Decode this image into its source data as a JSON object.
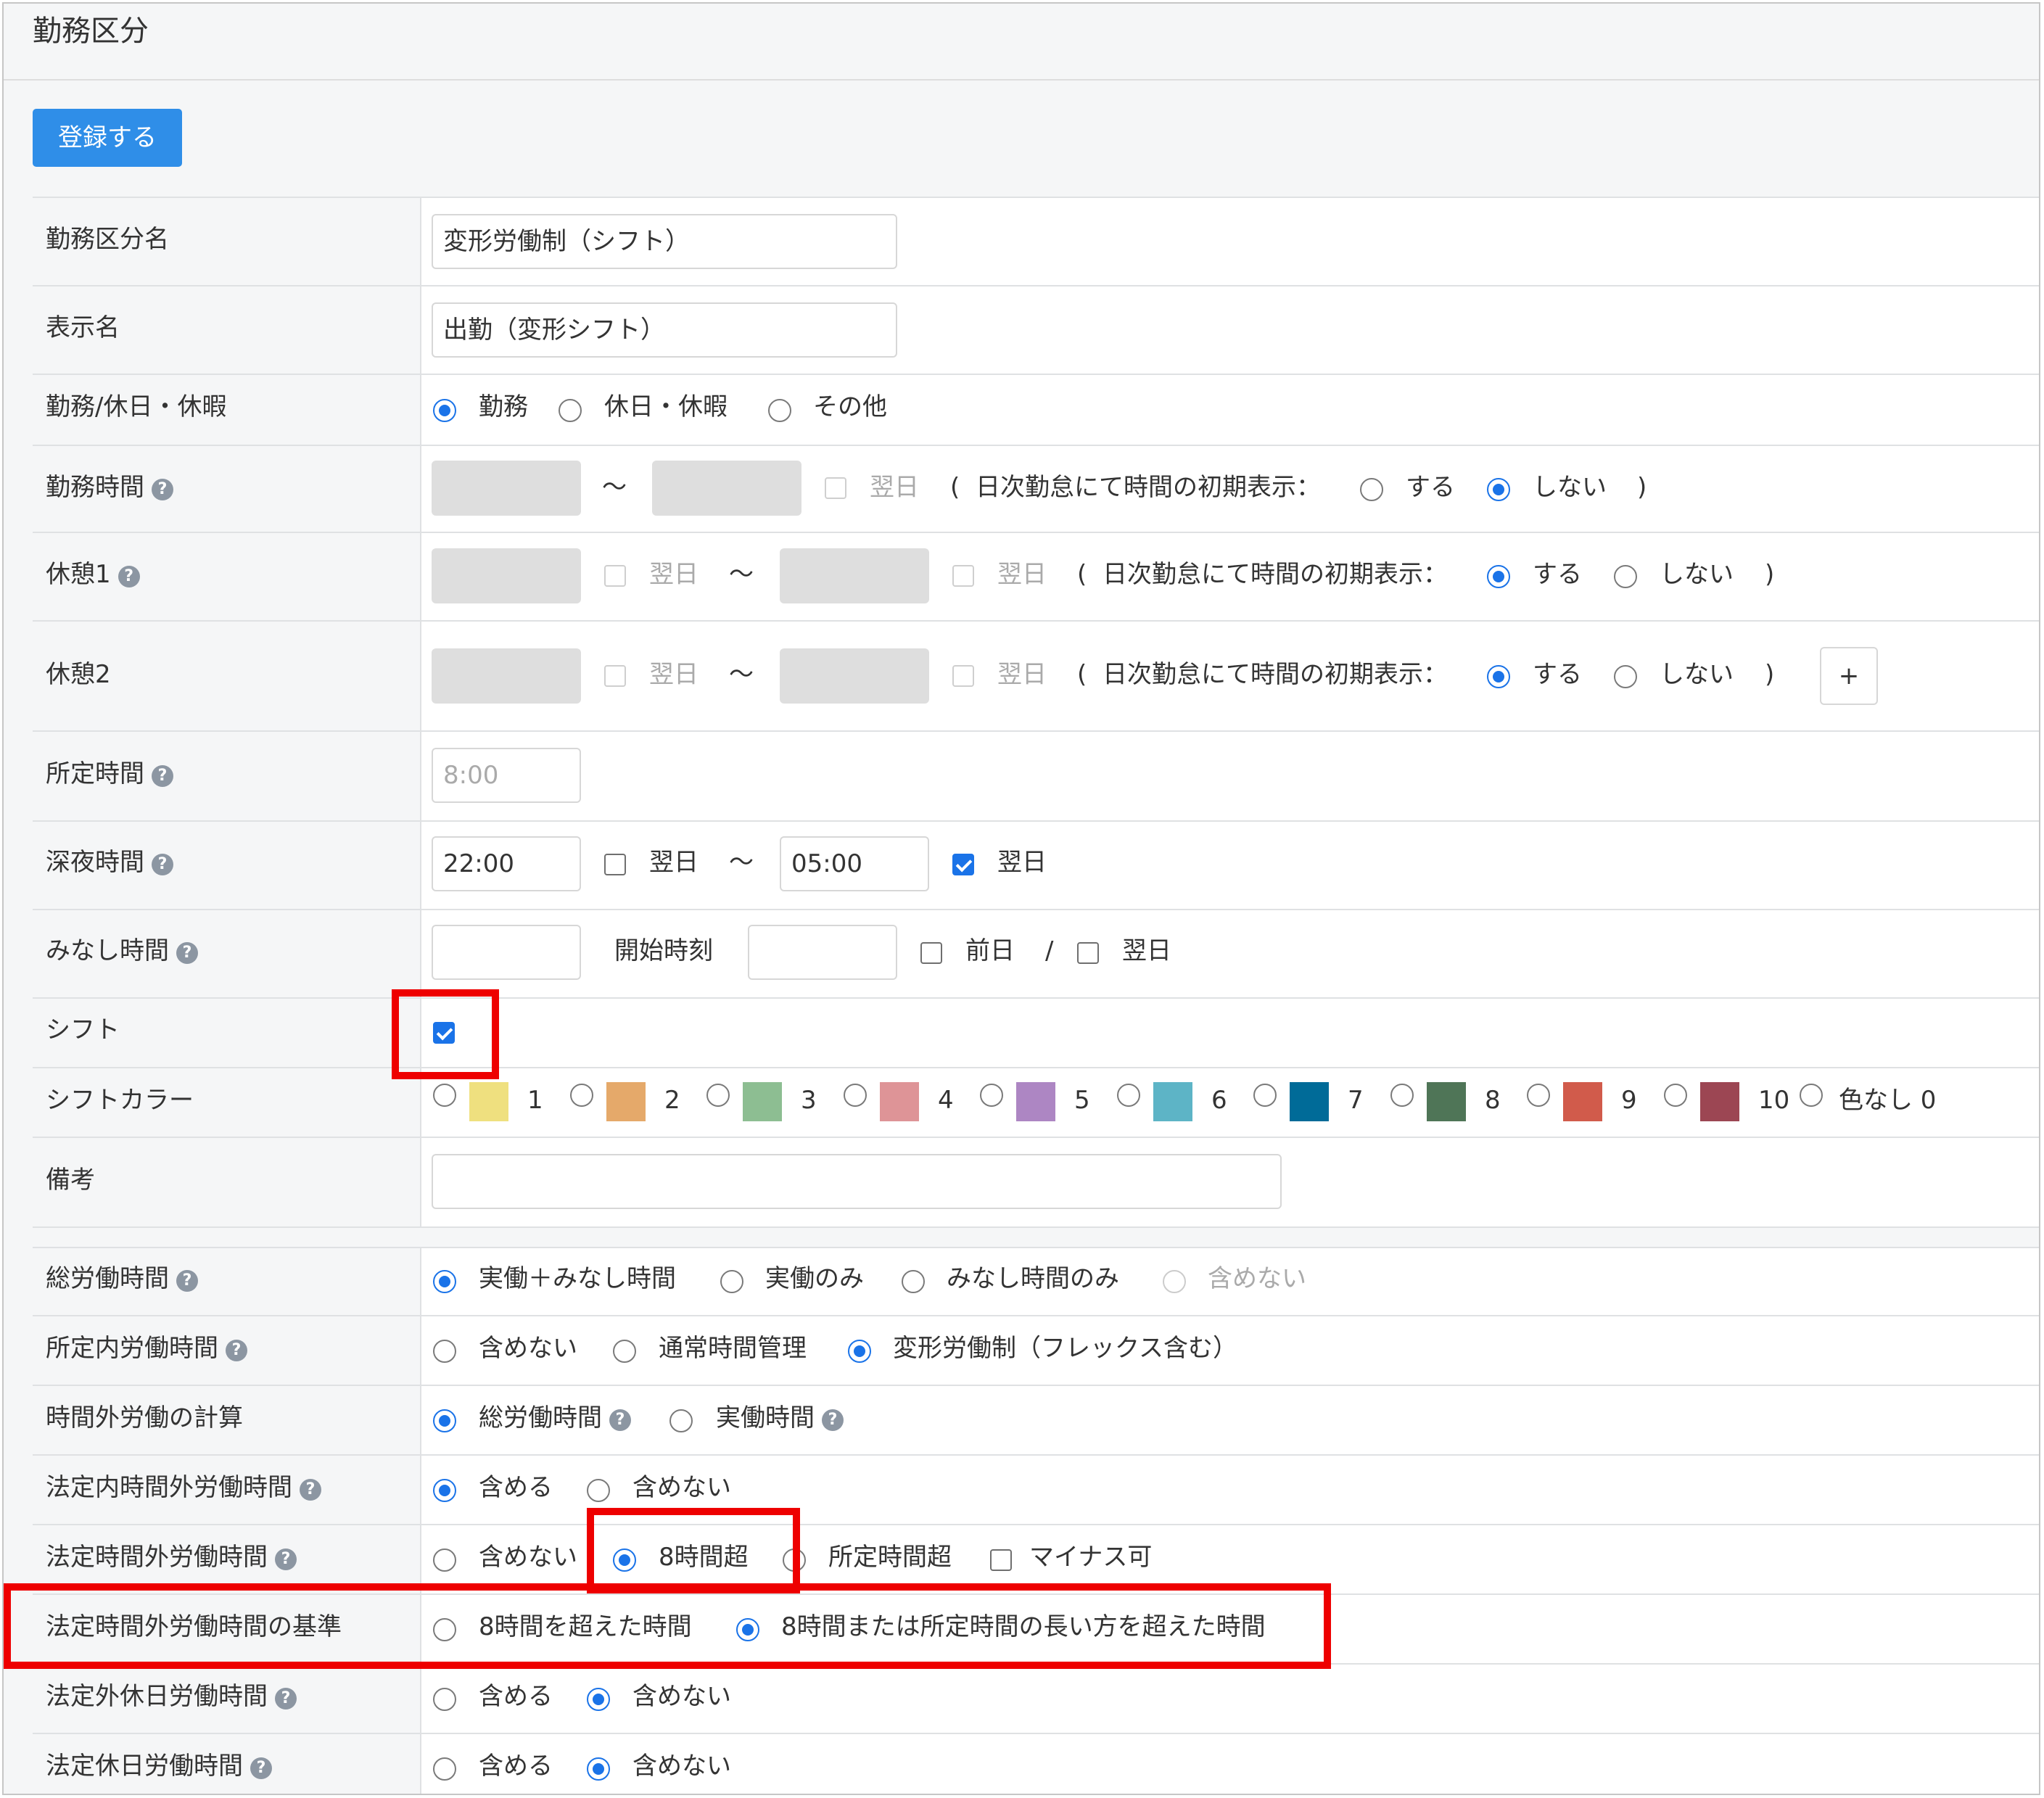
{
  "page": {
    "title": "勤務区分",
    "submit_label": "登録する"
  },
  "form": {
    "name": {
      "label": "勤務区分名",
      "value": "変形労働制（シフト）"
    },
    "display_name": {
      "label": "表示名",
      "value": "出勤（変形シフト）"
    },
    "work_type": {
      "label": "勤務/休日・休暇",
      "options": [
        "勤務",
        "休日・休暇",
        "その他"
      ],
      "selected": "勤務"
    },
    "work_hours": {
      "label": "勤務時間",
      "tilde": "〜",
      "next_day_label": "翌日",
      "paren_open": "(",
      "paren_close": ")",
      "initial_display_label": "日次勤怠にて時間の初期表示：",
      "opt_yes": "する",
      "opt_no": "しない",
      "selected": "しない"
    },
    "break1": {
      "label": "休憩1",
      "next_day_label": "翌日",
      "tilde": "〜",
      "initial_display_label": "日次勤怠にて時間の初期表示：",
      "opt_yes": "する",
      "opt_no": "しない",
      "selected": "する"
    },
    "break2": {
      "label": "休憩2",
      "next_day_label": "翌日",
      "tilde": "〜",
      "initial_display_label": "日次勤怠にて時間の初期表示：",
      "opt_yes": "する",
      "opt_no": "しない",
      "selected": "する",
      "add_label": "+"
    },
    "scheduled_hours": {
      "label": "所定時間",
      "placeholder": "8:00"
    },
    "night_hours": {
      "label": "深夜時間",
      "start": "22:00",
      "start_next_day": false,
      "end": "05:00",
      "end_next_day": true,
      "next_day_label": "翌日",
      "tilde": "〜"
    },
    "deemed_hours": {
      "label": "みなし時間",
      "start_time_label": "開始時刻",
      "prev_day_label": "前日",
      "slash": "/",
      "next_day_label": "翌日"
    },
    "shift": {
      "label": "シフト",
      "checked": true
    },
    "shift_color": {
      "label": "シフトカラー",
      "colors": [
        {
          "num": "1",
          "color": "#efe07f"
        },
        {
          "num": "2",
          "color": "#e5a96a"
        },
        {
          "num": "3",
          "color": "#8dbe92"
        },
        {
          "num": "4",
          "color": "#de9497"
        },
        {
          "num": "5",
          "color": "#ad86c3"
        },
        {
          "num": "6",
          "color": "#5db4c6"
        },
        {
          "num": "7",
          "color": "#006b98"
        },
        {
          "num": "8",
          "color": "#4f7557"
        },
        {
          "num": "9",
          "color": "#d15b4b"
        },
        {
          "num": "10",
          "color": "#9c4653"
        }
      ],
      "none_label": "色なし 0"
    },
    "note": {
      "label": "備考",
      "value": ""
    }
  },
  "calc": {
    "total_hours": {
      "label": "総労働時間",
      "options": [
        "実働＋みなし時間",
        "実働のみ",
        "みなし時間のみ",
        "含めない"
      ],
      "selected": "実働＋みなし時間"
    },
    "scheduled_work": {
      "label": "所定内労働時間",
      "options": [
        "含めない",
        "通常時間管理",
        "変形労働制（フレックス含む）"
      ],
      "selected": "変形労働制（フレックス含む）"
    },
    "overtime_calc": {
      "label": "時間外労働の計算",
      "options": [
        "総労働時間",
        "実働時間"
      ],
      "selected": "総労働時間"
    },
    "legal_inner_overtime": {
      "label": "法定内時間外労働時間",
      "options": [
        "含める",
        "含めない"
      ],
      "selected": "含める"
    },
    "legal_overtime": {
      "label": "法定時間外労働時間",
      "options": [
        "含めない",
        "8時間超",
        "所定時間超"
      ],
      "selected": "8時間超",
      "minus_label": "マイナス可"
    },
    "legal_overtime_basis": {
      "label": "法定時間外労働時間の基準",
      "options": [
        "8時間を超えた時間",
        "8時間または所定時間の長い方を超えた時間"
      ],
      "selected": "8時間または所定時間の長い方を超えた時間"
    },
    "non_legal_holiday": {
      "label": "法定外休日労働時間",
      "options": [
        "含める",
        "含めない"
      ],
      "selected": "含めない"
    },
    "legal_holiday": {
      "label": "法定休日労働時間",
      "options": [
        "含める",
        "含めない"
      ],
      "selected": "含めない"
    }
  },
  "help_icon": "question-circle-icon",
  "colors": {
    "primary": "#2f8ee8",
    "radio_selected": "#1a73e8",
    "highlight": "#ee0000"
  }
}
